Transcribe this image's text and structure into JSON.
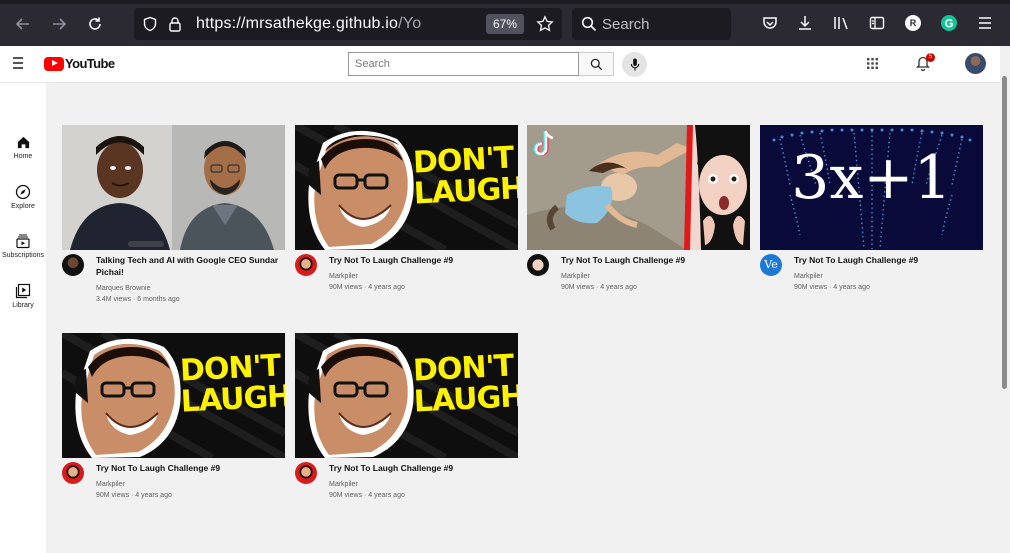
{
  "browser": {
    "url_host": "https://mrsathekge.github.io",
    "url_path": "/YoutubeFr",
    "zoom": "67%",
    "search_placeholder": "Search",
    "profile_initial": "R"
  },
  "header": {
    "logo_text": "YouTube",
    "search_placeholder": "Search",
    "notification_count": "5"
  },
  "sidebar": {
    "items": [
      {
        "label": "Home",
        "icon": "home-icon"
      },
      {
        "label": "Explore",
        "icon": "compass-icon"
      },
      {
        "label": "Subscriptions",
        "icon": "subscriptions-icon"
      },
      {
        "label": "Library",
        "icon": "library-icon"
      }
    ]
  },
  "videos": [
    {
      "title": "Talking Tech and AI with Google CEO Sundar Pichai!",
      "channel": "Marques Brownie",
      "stats": "3.4M views · 6 months ago"
    },
    {
      "title": "Try Not To Laugh Challenge #9",
      "channel": "Markpiler",
      "stats": "90M views · 4 years ago"
    },
    {
      "title": "Try Not To Laugh Challenge #9",
      "channel": "Markpiler",
      "stats": "90M views · 4 years ago"
    },
    {
      "title": "Try Not To Laugh Challenge #9",
      "channel": "Markpiler",
      "stats": "90M views · 4 years ago"
    },
    {
      "title": "Try Not To Laugh Challenge #9",
      "channel": "Markpiler",
      "stats": "90M views · 4 years ago"
    },
    {
      "title": "Try Not To Laugh Challenge #9",
      "channel": "Markpiler",
      "stats": "90M views · 4 years ago"
    }
  ],
  "thumbnail_text": {
    "laugh_line1": "DON'T",
    "laugh_line2": "LAUGH",
    "math": "3x+1",
    "math_channel_avatar": "Ve"
  },
  "colors": {
    "yt_red": "#ff0000",
    "chrome_bg": "#2b2a33",
    "page_bg": "#f1f1f1",
    "laugh_yellow": "#fff200"
  }
}
